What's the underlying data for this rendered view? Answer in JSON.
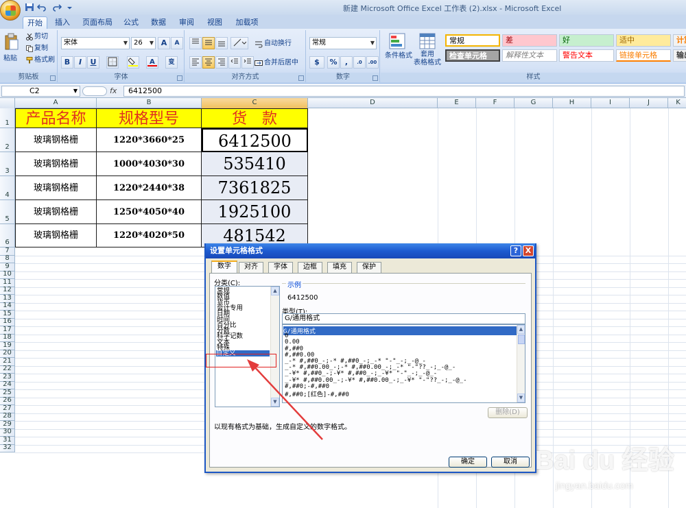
{
  "window": {
    "title": "新建 Microsoft Office Excel 工作表 (2).xlsx - Microsoft Excel"
  },
  "tabs": [
    "开始",
    "插入",
    "页面布局",
    "公式",
    "数据",
    "审阅",
    "视图",
    "加载项"
  ],
  "ribbon": {
    "clipboard": {
      "label": "剪贴板",
      "paste": "粘贴",
      "cut": "剪切",
      "copy": "复制",
      "format_painter": "格式刷"
    },
    "font": {
      "label": "字体",
      "name": "宋体",
      "size": "26",
      "bold": "B",
      "italic": "I",
      "underline": "U",
      "grow": "A",
      "shrink": "A",
      "phonetic": "变"
    },
    "alignment": {
      "label": "对齐方式",
      "wrap": "自动换行",
      "merge": "合并后居中"
    },
    "number": {
      "label": "数字",
      "format": "常规",
      "currency": "$",
      "percent": "%",
      "comma": ","
    },
    "styles": {
      "label": "样式",
      "conditional": "条件格式",
      "table": "套用\n表格格式",
      "cells": [
        "常规",
        "差",
        "好",
        "适中",
        "计算",
        "检查单元格",
        "解释性文本",
        "警告文本",
        "链接单元格",
        "输出"
      ]
    }
  },
  "formula_bar": {
    "namebox": "C2",
    "fx": "fx",
    "value": "6412500"
  },
  "sheet": {
    "columns": [
      "A",
      "B",
      "C",
      "D",
      "E",
      "F",
      "G",
      "H",
      "I",
      "J",
      "K"
    ],
    "rows": [
      "1",
      "2",
      "3",
      "4",
      "5",
      "6",
      "7",
      "8",
      "9",
      "10",
      "11",
      "12",
      "13",
      "14",
      "15",
      "16",
      "17",
      "18",
      "19",
      "20",
      "21",
      "22",
      "23",
      "24",
      "25",
      "26",
      "27",
      "28",
      "29",
      "30",
      "31",
      "32"
    ],
    "header": [
      "产品名称",
      "规格型号",
      "货　款"
    ],
    "data": [
      [
        "玻璃钢格栅",
        "1220*3660*25",
        "6412500"
      ],
      [
        "玻璃钢格栅",
        "1000*4030*30",
        "535410"
      ],
      [
        "玻璃钢格栅",
        "1220*2440*38",
        "7361825"
      ],
      [
        "玻璃钢格栅",
        "1250*4050*40",
        "1925100"
      ],
      [
        "玻璃钢格栅",
        "1220*4020*50",
        "481542"
      ]
    ]
  },
  "dialog": {
    "title": "设置单元格格式",
    "tabs": [
      "数字",
      "对齐",
      "字体",
      "边框",
      "填充",
      "保护"
    ],
    "category_label": "分类(C):",
    "categories": [
      "常规",
      "数值",
      "货币",
      "会计专用",
      "日期",
      "时间",
      "百分比",
      "分数",
      "科学记数",
      "文本",
      "特殊",
      "自定义"
    ],
    "sample_label": "示例",
    "sample_value": "6412500",
    "type_label": "类型(T):",
    "type_value": "G/通用格式",
    "formats": [
      "G/通用格式",
      "0",
      "0.00",
      "#,##0",
      "#,##0.00",
      "_-* #,##0_-;-* #,##0_-;_-* \"-\"_-;_-@_-",
      "_-* #,##0.00_-;-* #,##0.00_-;_-* \"-\"??_-;_-@_-",
      "_-¥* #,##0_-;-¥* #,##0_-;_-¥* \"-\"_-;_-@_-",
      "_-¥* #,##0.00_-;-¥* #,##0.00_-;_-¥* \"-\"??_-;_-@_-",
      "#,##0;-#,##0",
      "#,##0;[红色]-#,##0"
    ],
    "delete": "删除(D)",
    "description": "以现有格式为基础，生成自定义的数字格式。",
    "ok": "确定",
    "cancel": "取消",
    "help": "?",
    "close": "X"
  },
  "watermark": {
    "brand": "Bai du 经验",
    "url": "jingyan.baidu.com"
  }
}
